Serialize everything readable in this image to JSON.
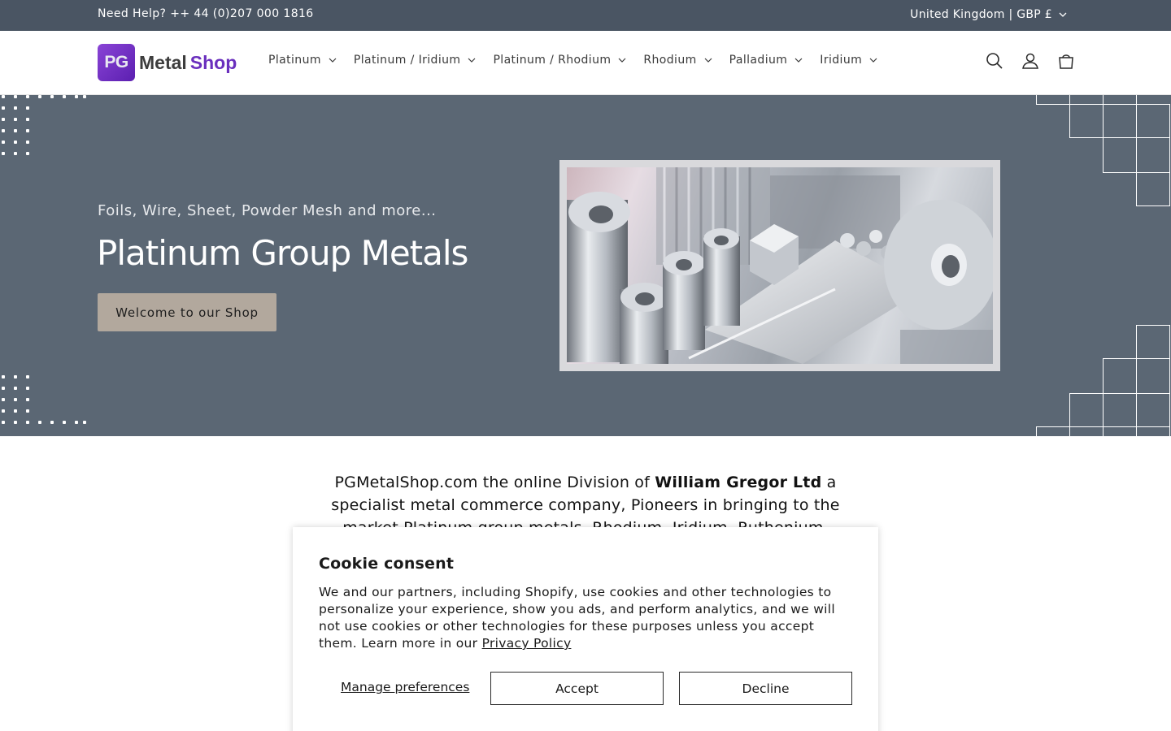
{
  "topbar": {
    "help_text": "Need Help? ++ 44 (0)207 000 1816",
    "locale_label": "United Kingdom | GBP £"
  },
  "logo": {
    "mark": "PG",
    "word1": "Metal",
    "word2": "Shop"
  },
  "nav": {
    "items": [
      {
        "label": "Platinum"
      },
      {
        "label": "Platinum / Iridium"
      },
      {
        "label": "Platinum / Rhodium"
      },
      {
        "label": "Rhodium"
      },
      {
        "label": "Palladium"
      },
      {
        "label": "Iridium"
      }
    ]
  },
  "header_icons": [
    "search-icon",
    "account-icon",
    "cart-icon"
  ],
  "hero": {
    "subtitle": "Foils, Wire, Sheet, Powder Mesh and more...",
    "title": "Platinum Group Metals",
    "cta_label": "Welcome to our Shop"
  },
  "intro": {
    "prefix": "PGMetalShop.com the online Division of ",
    "company": "William Gregor Ltd",
    "suffix": " a specialist metal commerce company, Pioneers in bringing to the market Platinum group metals, Rhodium, Iridium, Ruthenium, Palladium and alloys of"
  },
  "cookie": {
    "title": "Cookie consent",
    "body": "We and our partners, including Shopify, use cookies and other technologies to personalize your experience, show you ads, and perform analytics, and we will not use cookies or other technologies for these purposes unless you accept them. Learn more in our ",
    "policy_link": "Privacy Policy",
    "manage_label": "Manage preferences",
    "accept_label": "Accept",
    "decline_label": "Decline"
  },
  "colors": {
    "topbar_bg": "#4a5563",
    "hero_bg": "#5b6774",
    "cta_bg": "#b2a89d",
    "brand_purple": "#6a2fbd"
  }
}
